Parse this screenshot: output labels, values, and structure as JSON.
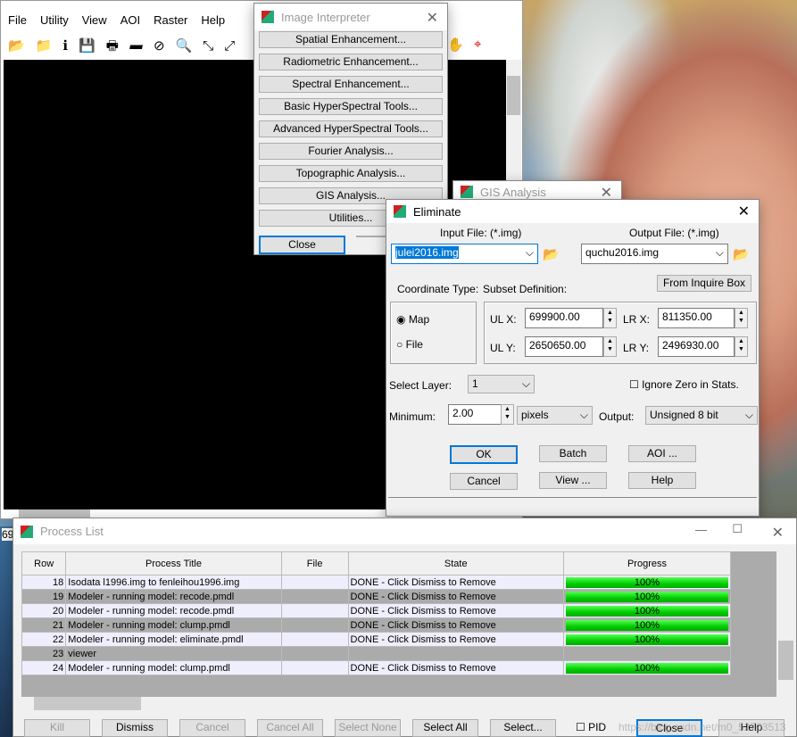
{
  "viewer": {
    "menu": [
      "File",
      "Utility",
      "View",
      "AOI",
      "Raster",
      "Help"
    ],
    "status": "69"
  },
  "image_interpreter": {
    "title": "Image Interpreter",
    "items": [
      "Spatial Enhancement...",
      "Radiometric Enhancement...",
      "Spectral Enhancement...",
      "Basic HyperSpectral Tools...",
      "Advanced HyperSpectral Tools...",
      "Fourier Analysis...",
      "Topographic Analysis...",
      "GIS Analysis...",
      "Utilities..."
    ],
    "close": "Close"
  },
  "gis_analysis": {
    "title": "GIS Analysis"
  },
  "eliminate": {
    "title": "Eliminate",
    "input_label": "Input File: (*.img)",
    "input_value": "julei2016.img",
    "output_label": "Output File: (*.img)",
    "output_value": "quchu2016.img",
    "coord_type_label": "Coordinate Type:",
    "subset_label": "Subset Definition:",
    "from_inquire": "From Inquire Box",
    "map": "Map",
    "file": "File",
    "coord_selected": "Map",
    "ulx_label": "UL X:",
    "ulx": "699900.00",
    "uly_label": "UL Y:",
    "uly": "2650650.00",
    "lrx_label": "LR X:",
    "lrx": "811350.00",
    "lry_label": "LR Y:",
    "lry": "2496930.00",
    "layer_label": "Select Layer:",
    "layer": "1",
    "ignore_zero": "Ignore Zero in Stats.",
    "ignore_zero_checked": false,
    "min_label": "Minimum:",
    "min_value": "2.00",
    "unit": "pixels",
    "output_label2": "Output:",
    "output_type": "Unsigned 8 bit",
    "ok": "OK",
    "batch": "Batch",
    "aoi": "AOI ...",
    "cancel": "Cancel",
    "view": "View ...",
    "help": "Help"
  },
  "process_list": {
    "title": "Process List",
    "columns": [
      "Row",
      "Process Title",
      "File",
      "State",
      "Progress"
    ],
    "rows": [
      {
        "row": "18",
        "title": "Isodata l1996.img to fenleihou1996.img",
        "file": "",
        "state": "DONE - Click Dismiss to Remove",
        "progress": "100%"
      },
      {
        "row": "19",
        "title": "Modeler - running model: recode.pmdl",
        "file": "",
        "state": "DONE - Click Dismiss to Remove",
        "progress": "100%"
      },
      {
        "row": "20",
        "title": "Modeler - running model: recode.pmdl",
        "file": "",
        "state": "DONE - Click Dismiss to Remove",
        "progress": "100%"
      },
      {
        "row": "21",
        "title": "Modeler - running model: clump.pmdl",
        "file": "",
        "state": "DONE - Click Dismiss to Remove",
        "progress": "100%"
      },
      {
        "row": "22",
        "title": "Modeler - running model: eliminate.pmdl",
        "file": "",
        "state": "DONE - Click Dismiss to Remove",
        "progress": "100%"
      },
      {
        "row": "23",
        "title": "viewer",
        "file": "",
        "state": "",
        "progress": ""
      },
      {
        "row": "24",
        "title": "Modeler - running model: clump.pmdl",
        "file": "",
        "state": "DONE - Click Dismiss to Remove",
        "progress": "100%"
      }
    ],
    "buttons": [
      "Kill",
      "Dismiss",
      "Cancel",
      "Cancel All",
      "Select None",
      "Select All",
      "Select...",
      "Close",
      "Help"
    ],
    "pid": "PID"
  },
  "watermark": "https://blog.csdn.net/m0_52703513"
}
